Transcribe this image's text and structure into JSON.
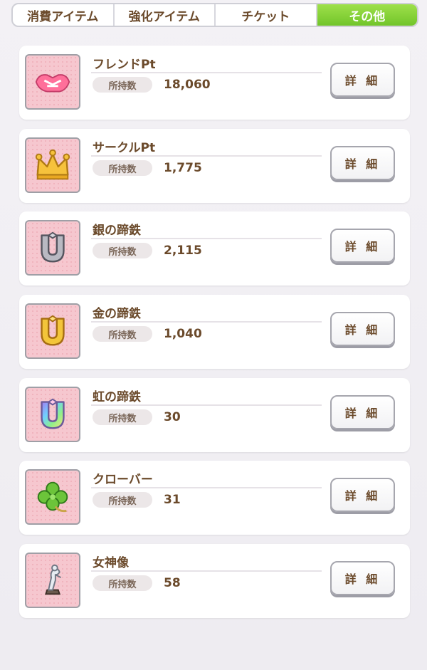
{
  "tabs": [
    {
      "label": "消費アイテム",
      "active": false
    },
    {
      "label": "強化アイテム",
      "active": false
    },
    {
      "label": "チケット",
      "active": false
    },
    {
      "label": "その他",
      "active": true
    }
  ],
  "qty_label": "所持数",
  "detail_label": "詳 細",
  "items": [
    {
      "name": "フレンドPt",
      "qty": "18,060",
      "icon": "handshake-icon"
    },
    {
      "name": "サークルPt",
      "qty": "1,775",
      "icon": "crown-icon"
    },
    {
      "name": "銀の蹄鉄",
      "qty": "2,115",
      "icon": "silver-horseshoe-icon"
    },
    {
      "name": "金の蹄鉄",
      "qty": "1,040",
      "icon": "gold-horseshoe-icon"
    },
    {
      "name": "虹の蹄鉄",
      "qty": "30",
      "icon": "rainbow-horseshoe-icon"
    },
    {
      "name": "クローバー",
      "qty": "31",
      "icon": "clover-icon"
    },
    {
      "name": "女神像",
      "qty": "58",
      "icon": "goddess-statue-icon"
    }
  ],
  "colors": {
    "active_tab": "#86d23a",
    "text_brown": "#6b4a2b",
    "icon_bg": "#f6c7cf"
  }
}
